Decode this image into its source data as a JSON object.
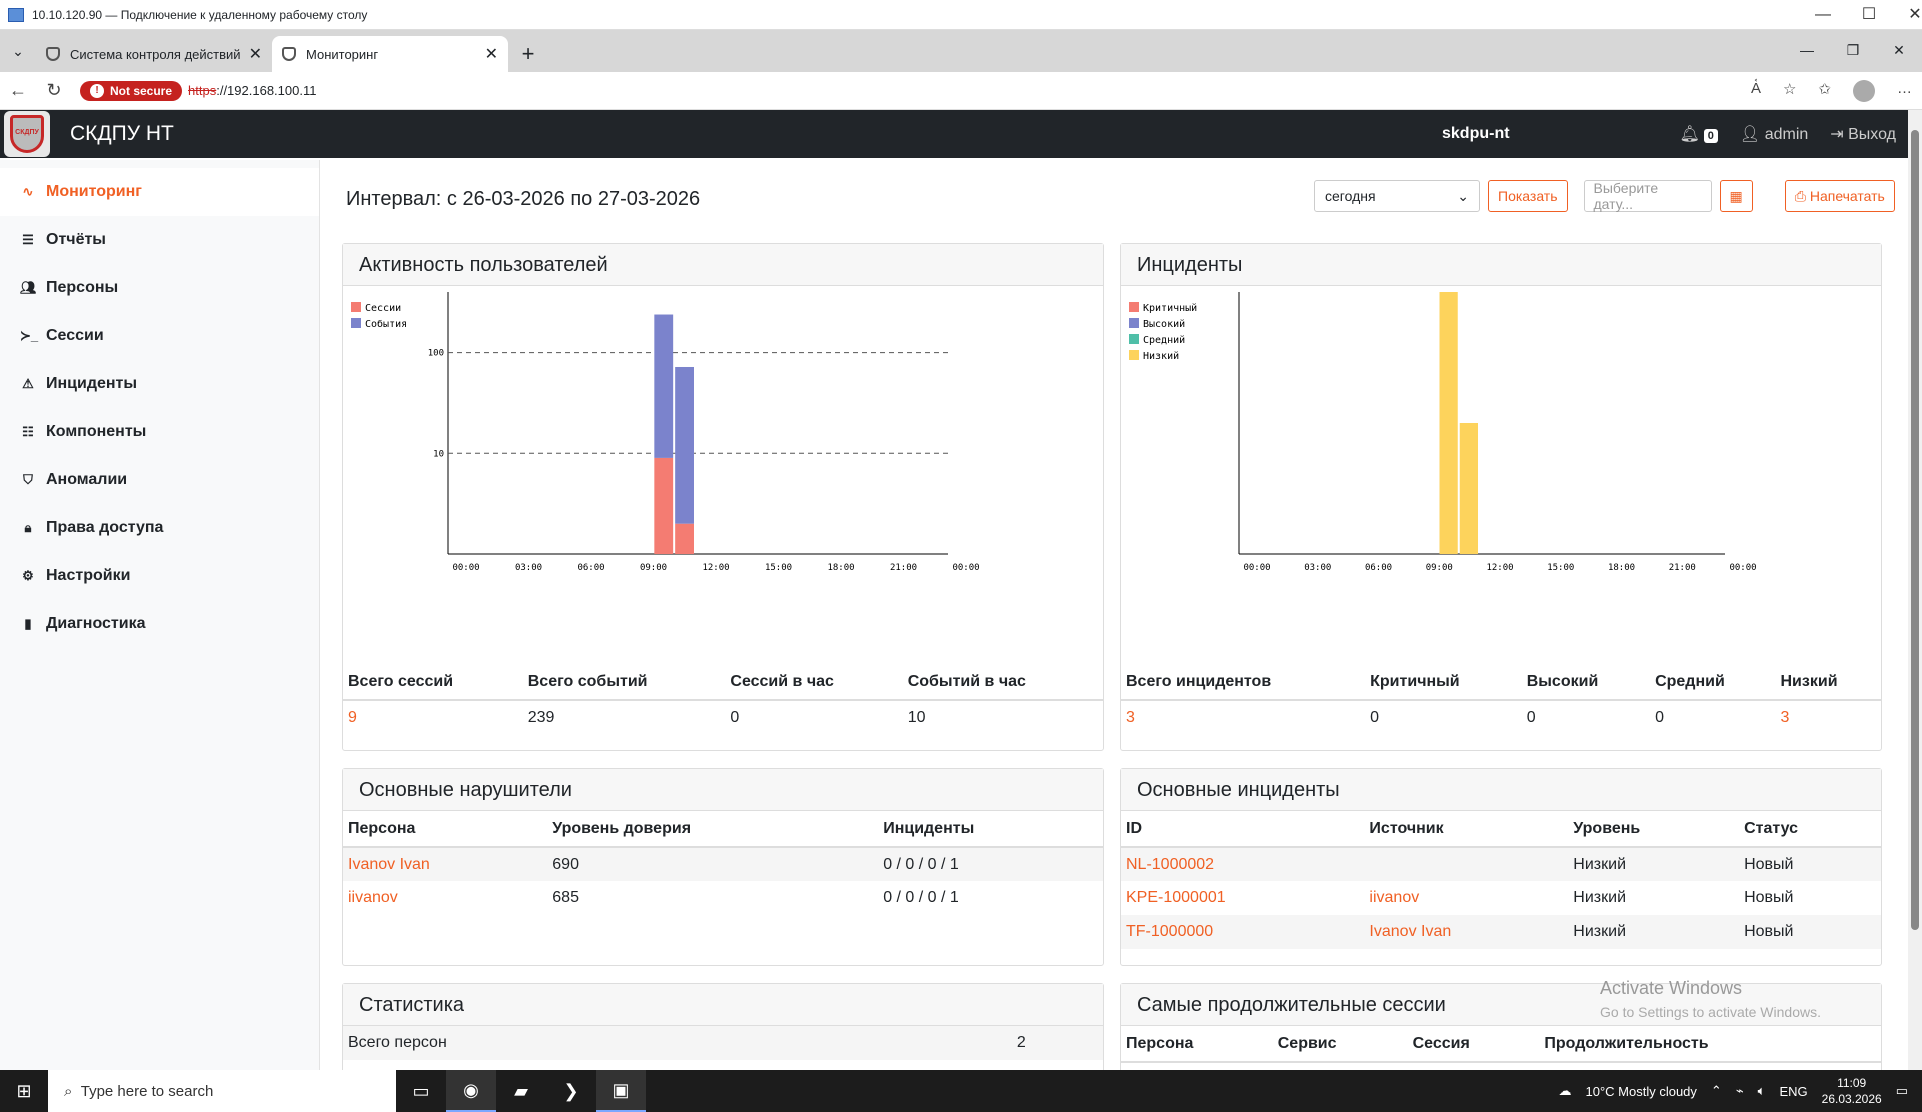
{
  "rdp": {
    "title": "10.10.120.90 — Подключение к удаленному рабочему столу"
  },
  "browser": {
    "tabs": [
      {
        "title": "Система контроля действий пост"
      },
      {
        "title": "Мониторинг"
      }
    ],
    "not_secure": "Not secure",
    "url_scheme": "https",
    "url_rest": "://192.168.100.11"
  },
  "navbar": {
    "brand": "СКДПУ НТ",
    "host": "skdpu-nt",
    "notif_count": "0",
    "user": "admin",
    "logout": "Выход",
    "logo_text": "СКДПУ"
  },
  "sidebar": {
    "items": [
      {
        "label": "Мониторинг",
        "icon": "activity-icon"
      },
      {
        "label": "Отчёты",
        "icon": "list-icon"
      },
      {
        "label": "Персоны",
        "icon": "users-icon"
      },
      {
        "label": "Сессии",
        "icon": "terminal-icon"
      },
      {
        "label": "Инциденты",
        "icon": "alert-triangle-icon"
      },
      {
        "label": "Компоненты",
        "icon": "server-icon"
      },
      {
        "label": "Аномалии",
        "icon": "shield-icon"
      },
      {
        "label": "Права доступа",
        "icon": "lock-icon"
      },
      {
        "label": "Настройки",
        "icon": "gear-icon"
      },
      {
        "label": "Диагностика",
        "icon": "bar-chart-icon"
      }
    ]
  },
  "filters": {
    "interval": "Интервал: с 26-03-2026 по 27-03-2026",
    "period": "сегодня",
    "show": "Показать",
    "date_placeholder": "Выберите дату...",
    "print": "Напечатать"
  },
  "activity": {
    "title": "Активность пользователей",
    "headers": [
      "Всего сессий",
      "Всего событий",
      "Сессий в час",
      "Событий в час"
    ],
    "values": [
      "9",
      "239",
      "0",
      "10"
    ]
  },
  "incidents": {
    "title": "Инциденты",
    "headers": [
      "Всего инцидентов",
      "Критичный",
      "Высокий",
      "Средний",
      "Низкий"
    ],
    "values": [
      "3",
      "0",
      "0",
      "0",
      "3"
    ]
  },
  "violators": {
    "title": "Основные нарушители",
    "headers": [
      "Персона",
      "Уровень доверия",
      "Инциденты"
    ],
    "rows": [
      [
        "Ivanov Ivan",
        "690",
        "0 / 0 / 0 / 1"
      ],
      [
        "iivanov",
        "685",
        "0 / 0 / 0 / 1"
      ]
    ]
  },
  "top_incidents": {
    "title": "Основные инциденты",
    "headers": [
      "ID",
      "Источник",
      "Уровень",
      "Статус"
    ],
    "rows": [
      [
        "NL-1000002",
        "",
        "Низкий",
        "Новый"
      ],
      [
        "KPE-1000001",
        "iivanov",
        "Низкий",
        "Новый"
      ],
      [
        "TF-1000000",
        "Ivanov Ivan",
        "Низкий",
        "Новый"
      ]
    ]
  },
  "stats": {
    "title": "Статистика",
    "rows": [
      [
        "Всего персон",
        "2"
      ]
    ]
  },
  "long_sessions": {
    "title": "Самые продолжительные сессии",
    "headers": [
      "Персона",
      "Сервис",
      "Сессия",
      "Продолжительность"
    ]
  },
  "watermark": {
    "line1": "Activate Windows",
    "line2": "Go to Settings to activate Windows."
  },
  "taskbar": {
    "search": "Type here to search",
    "weather": "10°C  Mostly cloudy",
    "lang": "ENG",
    "time": "11:09",
    "date": "26.03.2026"
  },
  "chart_data": [
    {
      "type": "bar",
      "title": "Активность пользователей",
      "yscale": "log",
      "yticks": [
        "10",
        "100"
      ],
      "xticks": [
        "00:00",
        "03:00",
        "06:00",
        "09:00",
        "12:00",
        "15:00",
        "18:00",
        "21:00",
        "00:00"
      ],
      "legend": [
        {
          "name": "Сессии",
          "color": "#f47c72"
        },
        {
          "name": "События",
          "color": "#7b83cc"
        }
      ],
      "bars": [
        {
          "hour": 10,
          "segments": [
            {
              "series": "Сессии",
              "value": 9
            },
            {
              "series": "События",
              "value": 230
            }
          ]
        },
        {
          "hour": 11,
          "segments": [
            {
              "series": "Сессии",
              "value": 2
            },
            {
              "series": "События",
              "value": 70
            }
          ]
        }
      ]
    },
    {
      "type": "bar",
      "title": "Инциденты",
      "xticks": [
        "00:00",
        "03:00",
        "06:00",
        "09:00",
        "12:00",
        "15:00",
        "18:00",
        "21:00",
        "00:00"
      ],
      "legend": [
        {
          "name": "Критичный",
          "color": "#f47c72"
        },
        {
          "name": "Высокий",
          "color": "#7b83cc"
        },
        {
          "name": "Средний",
          "color": "#4fbfa8"
        },
        {
          "name": "Низкий",
          "color": "#fdd35c"
        }
      ],
      "bars": [
        {
          "hour": 10,
          "segments": [
            {
              "series": "Низкий",
              "value": 2
            }
          ]
        },
        {
          "hour": 11,
          "segments": [
            {
              "series": "Низкий",
              "value": 1
            }
          ]
        }
      ]
    }
  ]
}
